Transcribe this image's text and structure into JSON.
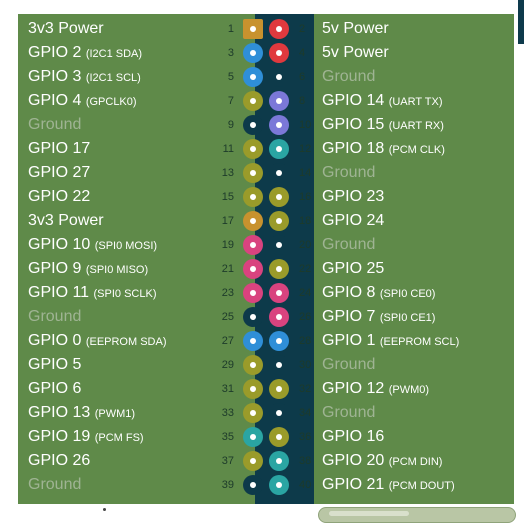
{
  "colors": {
    "power3v3": "#c8922e",
    "power5v": "#e0393e",
    "ground": "#0d3a4a",
    "gpio": "#9a9b2a",
    "i2c": "#2f8fd8",
    "uart": "#7b78d8",
    "pcm": "#2aa5a3",
    "spi": "#d9437f"
  },
  "pins": [
    {
      "l": {
        "num": "1",
        "name": "3v3 Power",
        "sub": "",
        "type": "power3v3",
        "shape": "square"
      },
      "r": {
        "num": "2",
        "name": "5v Power",
        "sub": "",
        "type": "power5v"
      }
    },
    {
      "l": {
        "num": "3",
        "name": "GPIO 2",
        "sub": "(I2C1 SDA)",
        "type": "i2c"
      },
      "r": {
        "num": "4",
        "name": "5v Power",
        "sub": "",
        "type": "power5v"
      }
    },
    {
      "l": {
        "num": "5",
        "name": "GPIO 3",
        "sub": "(I2C1 SCL)",
        "type": "i2c"
      },
      "r": {
        "num": "6",
        "name": "Ground",
        "sub": "",
        "type": "ground"
      }
    },
    {
      "l": {
        "num": "7",
        "name": "GPIO 4",
        "sub": "(GPCLK0)",
        "type": "gpio"
      },
      "r": {
        "num": "8",
        "name": "GPIO 14",
        "sub": "(UART TX)",
        "type": "uart"
      }
    },
    {
      "l": {
        "num": "9",
        "name": "Ground",
        "sub": "",
        "type": "ground"
      },
      "r": {
        "num": "10",
        "name": "GPIO 15",
        "sub": "(UART RX)",
        "type": "uart"
      }
    },
    {
      "l": {
        "num": "11",
        "name": "GPIO 17",
        "sub": "",
        "type": "gpio"
      },
      "r": {
        "num": "12",
        "name": "GPIO 18",
        "sub": "(PCM CLK)",
        "type": "pcm"
      }
    },
    {
      "l": {
        "num": "13",
        "name": "GPIO 27",
        "sub": "",
        "type": "gpio"
      },
      "r": {
        "num": "14",
        "name": "Ground",
        "sub": "",
        "type": "ground"
      }
    },
    {
      "l": {
        "num": "15",
        "name": "GPIO 22",
        "sub": "",
        "type": "gpio"
      },
      "r": {
        "num": "16",
        "name": "GPIO 23",
        "sub": "",
        "type": "gpio"
      }
    },
    {
      "l": {
        "num": "17",
        "name": "3v3 Power",
        "sub": "",
        "type": "power3v3"
      },
      "r": {
        "num": "18",
        "name": "GPIO 24",
        "sub": "",
        "type": "gpio"
      }
    },
    {
      "l": {
        "num": "19",
        "name": "GPIO 10",
        "sub": "(SPI0 MOSI)",
        "type": "spi"
      },
      "r": {
        "num": "20",
        "name": "Ground",
        "sub": "",
        "type": "ground"
      }
    },
    {
      "l": {
        "num": "21",
        "name": "GPIO 9",
        "sub": "(SPI0 MISO)",
        "type": "spi"
      },
      "r": {
        "num": "22",
        "name": "GPIO 25",
        "sub": "",
        "type": "gpio"
      }
    },
    {
      "l": {
        "num": "23",
        "name": "GPIO 11",
        "sub": "(SPI0 SCLK)",
        "type": "spi"
      },
      "r": {
        "num": "24",
        "name": "GPIO 8",
        "sub": "(SPI0 CE0)",
        "type": "spi"
      }
    },
    {
      "l": {
        "num": "25",
        "name": "Ground",
        "sub": "",
        "type": "ground"
      },
      "r": {
        "num": "26",
        "name": "GPIO 7",
        "sub": "(SPI0 CE1)",
        "type": "spi"
      }
    },
    {
      "l": {
        "num": "27",
        "name": "GPIO 0",
        "sub": "(EEPROM SDA)",
        "type": "i2c"
      },
      "r": {
        "num": "28",
        "name": "GPIO 1",
        "sub": "(EEPROM SCL)",
        "type": "i2c"
      }
    },
    {
      "l": {
        "num": "29",
        "name": "GPIO 5",
        "sub": "",
        "type": "gpio"
      },
      "r": {
        "num": "30",
        "name": "Ground",
        "sub": "",
        "type": "ground"
      }
    },
    {
      "l": {
        "num": "31",
        "name": "GPIO 6",
        "sub": "",
        "type": "gpio"
      },
      "r": {
        "num": "32",
        "name": "GPIO 12",
        "sub": "(PWM0)",
        "type": "gpio"
      }
    },
    {
      "l": {
        "num": "33",
        "name": "GPIO 13",
        "sub": "(PWM1)",
        "type": "gpio"
      },
      "r": {
        "num": "34",
        "name": "Ground",
        "sub": "",
        "type": "ground"
      }
    },
    {
      "l": {
        "num": "35",
        "name": "GPIO 19",
        "sub": "(PCM FS)",
        "type": "pcm"
      },
      "r": {
        "num": "36",
        "name": "GPIO 16",
        "sub": "",
        "type": "gpio"
      }
    },
    {
      "l": {
        "num": "37",
        "name": "GPIO 26",
        "sub": "",
        "type": "gpio"
      },
      "r": {
        "num": "38",
        "name": "GPIO 20",
        "sub": "(PCM DIN)",
        "type": "pcm"
      }
    },
    {
      "l": {
        "num": "39",
        "name": "Ground",
        "sub": "",
        "type": "ground"
      },
      "r": {
        "num": "40",
        "name": "GPIO 21",
        "sub": "(PCM DOUT)",
        "type": "pcm"
      }
    }
  ]
}
